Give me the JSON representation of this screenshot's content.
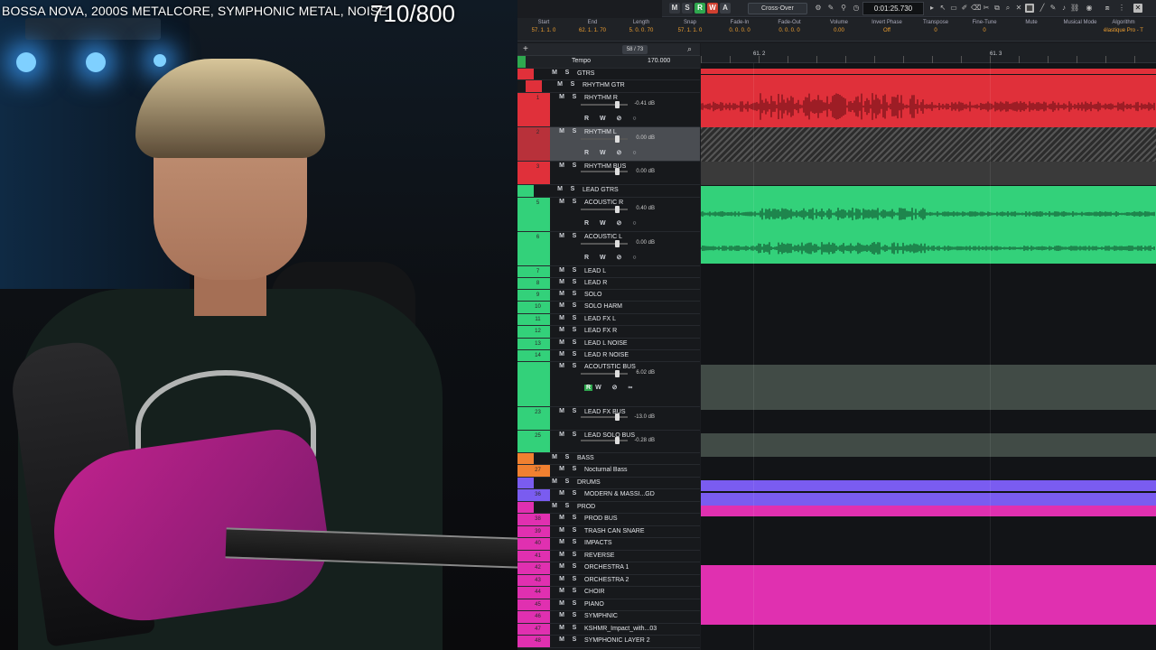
{
  "stream": {
    "title": "BOSSA NOVA, 2000S METALCORE, SYMPHONIC METAL, NOISE",
    "counter": "710/800"
  },
  "daw": {
    "topbar": {
      "buttons": [
        "M",
        "S",
        "R",
        "W",
        "A"
      ],
      "crossfade_mode": "Cross-Over",
      "position_time": "0:01:25.730"
    },
    "infoline": {
      "columns": [
        {
          "label": "Start",
          "value": "57. 1. 1. 0"
        },
        {
          "label": "End",
          "value": "62. 1. 1. 70"
        },
        {
          "label": "Length",
          "value": "5. 0. 0. 70"
        },
        {
          "label": "Snap",
          "value": "57. 1. 1. 0"
        },
        {
          "label": "Fade-In",
          "value": "0. 0. 0. 0"
        },
        {
          "label": "Fade-Out",
          "value": "0. 0. 0. 0"
        },
        {
          "label": "Volume",
          "value": "0.00"
        },
        {
          "label": "Invert Phase",
          "value": "Off"
        },
        {
          "label": "Transpose",
          "value": "0"
        },
        {
          "label": "Fine-Tune",
          "value": "0"
        },
        {
          "label": "Mute",
          "value": ""
        },
        {
          "label": "Musical Mode",
          "value": ""
        },
        {
          "label": "Algorithm",
          "value": "élastique Pro - T"
        }
      ]
    },
    "tracklist_toolbar": {
      "count": "58 / 73"
    },
    "tempo_track": {
      "name": "Tempo",
      "bpm": "170.000"
    },
    "ruler": {
      "markers": [
        "61. 2",
        "61. 3"
      ]
    },
    "tracks": [
      {
        "num": "",
        "name": "GTRS",
        "type": "folder",
        "color": "#e0303a"
      },
      {
        "num": "",
        "name": "RHYTHM GTR",
        "type": "folder",
        "color": "#e0303a"
      },
      {
        "num": "1",
        "name": "RHYTHM R",
        "type": "audio",
        "color": "#e0303a",
        "db": "-0.41 dB"
      },
      {
        "num": "2",
        "name": "RHYTHM L",
        "type": "audio",
        "color": "#e0303a",
        "db": "0.00 dB",
        "selected": true
      },
      {
        "num": "3",
        "name": "RHYTHM BUS",
        "type": "bus",
        "color": "#e0303a",
        "db": "0.00 dB"
      },
      {
        "num": "",
        "name": "LEAD GTRS",
        "type": "folder",
        "color": "#33d17a"
      },
      {
        "num": "5",
        "name": "ACOUSTIC R",
        "type": "audio",
        "color": "#33d17a",
        "db": "0.40 dB"
      },
      {
        "num": "6",
        "name": "ACOUSTIC L",
        "type": "audio",
        "color": "#33d17a",
        "db": "0.00 dB"
      },
      {
        "num": "7",
        "name": "LEAD L",
        "color": "#33d17a"
      },
      {
        "num": "8",
        "name": "LEAD R",
        "color": "#33d17a"
      },
      {
        "num": "9",
        "name": "SOLO",
        "color": "#33d17a"
      },
      {
        "num": "10",
        "name": "SOLO HARM",
        "color": "#33d17a"
      },
      {
        "num": "11",
        "name": "LEAD FX L",
        "color": "#33d17a"
      },
      {
        "num": "12",
        "name": "LEAD FX R",
        "color": "#33d17a"
      },
      {
        "num": "13",
        "name": "LEAD L NOISE",
        "color": "#33d17a"
      },
      {
        "num": "14",
        "name": "LEAD R NOISE",
        "color": "#33d17a"
      },
      {
        "num": "",
        "name": "ACOUTSTIC BUS",
        "type": "bus",
        "color": "#33d17a",
        "db": "6.02 dB"
      },
      {
        "num": "23",
        "name": "LEAD FX BUS",
        "type": "bus",
        "color": "#33d17a",
        "db": "-13.0 dB"
      },
      {
        "num": "25",
        "name": "LEAD SOLO BUS",
        "type": "bus",
        "color": "#33d17a",
        "db": "-0.28 dB"
      },
      {
        "num": "",
        "name": "BASS",
        "type": "folder",
        "color": "#f08030"
      },
      {
        "num": "27",
        "name": "Nocturnal Bass",
        "color": "#f08030"
      },
      {
        "num": "",
        "name": "DRUMS",
        "type": "folder",
        "color": "#7a5cf0"
      },
      {
        "num": "36",
        "name": "MODERN & MASSI...GD",
        "color": "#7a5cf0"
      },
      {
        "num": "",
        "name": "PROD",
        "type": "folder",
        "color": "#e030b0"
      },
      {
        "num": "38",
        "name": "PROD BUS",
        "color": "#e030b0"
      },
      {
        "num": "39",
        "name": "TRASH CAN SNARE",
        "color": "#e030b0"
      },
      {
        "num": "40",
        "name": "IMPACTS",
        "color": "#e030b0"
      },
      {
        "num": "41",
        "name": "REVERSE",
        "color": "#e030b0"
      },
      {
        "num": "42",
        "name": "ORCHESTRA 1",
        "color": "#e030b0"
      },
      {
        "num": "43",
        "name": "ORCHESTRA 2",
        "color": "#e030b0"
      },
      {
        "num": "44",
        "name": "CHOIR",
        "color": "#e030b0"
      },
      {
        "num": "45",
        "name": "PIANO",
        "color": "#e030b0"
      },
      {
        "num": "46",
        "name": "SYMPHNIC",
        "color": "#e030b0"
      },
      {
        "num": "47",
        "name": "KSHMR_Impact_with...03",
        "color": "#e030b0"
      },
      {
        "num": "48",
        "name": "SYMPHONIC LAYER 2",
        "color": "#e030b0"
      }
    ]
  }
}
